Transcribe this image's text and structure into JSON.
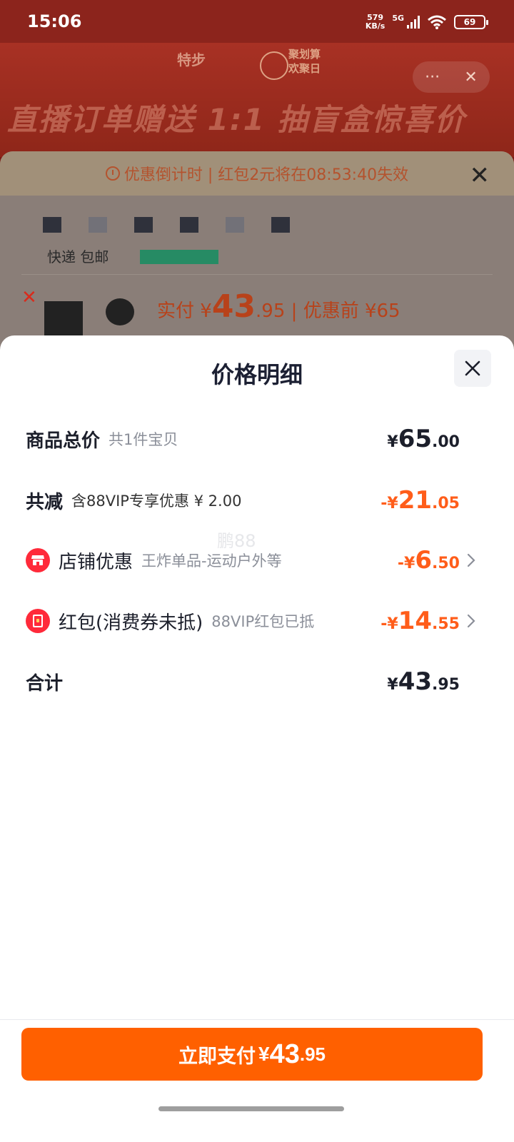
{
  "status_bar": {
    "time": "15:06",
    "net_speed_value": "579",
    "net_speed_unit": "KB/s",
    "network": "5G",
    "battery": "69"
  },
  "background": {
    "brand_logo": "特步",
    "festival": [
      "聚划算",
      "欢聚日"
    ],
    "slogan": "直播订单赠送 1:1 抽盲盒惊喜价",
    "countdown_text": "优惠倒计时 | 红包2元将在08:53:40失效",
    "shipping": "快递 包邮",
    "price_label": "实付 ¥",
    "price_int": "43",
    "price_dec": ".95",
    "price_before": "| 优惠前 ¥65"
  },
  "sheet": {
    "title": "价格明细",
    "watermark": "鹏88",
    "rows": [
      {
        "label": "商品总价",
        "sub": "共1件宝贝",
        "cur": "¥",
        "int": "65",
        "dec": ".00"
      },
      {
        "label": "共减",
        "sub": "含88VIP专享优惠 ¥ 2.00",
        "cur": "-¥",
        "int": "21",
        "dec": ".05"
      },
      {
        "label": "店铺优惠",
        "sub": "王炸单品-运动户外等",
        "cur": "-¥",
        "int": "6",
        "dec": ".50"
      },
      {
        "label": "红包(消费券未抵)",
        "sub": "88VIP红包已抵",
        "cur": "-¥",
        "int": "14",
        "dec": ".55"
      },
      {
        "label": "合计",
        "sub": "",
        "cur": "¥",
        "int": "43",
        "dec": ".95"
      }
    ]
  },
  "pay_button": {
    "label": "立即支付",
    "cur": "¥",
    "int": "43",
    "dec": ".95"
  },
  "colors": {
    "accent": "#ff6000",
    "discount": "#ff5d1a",
    "icon_red": "#ff2a3a"
  }
}
